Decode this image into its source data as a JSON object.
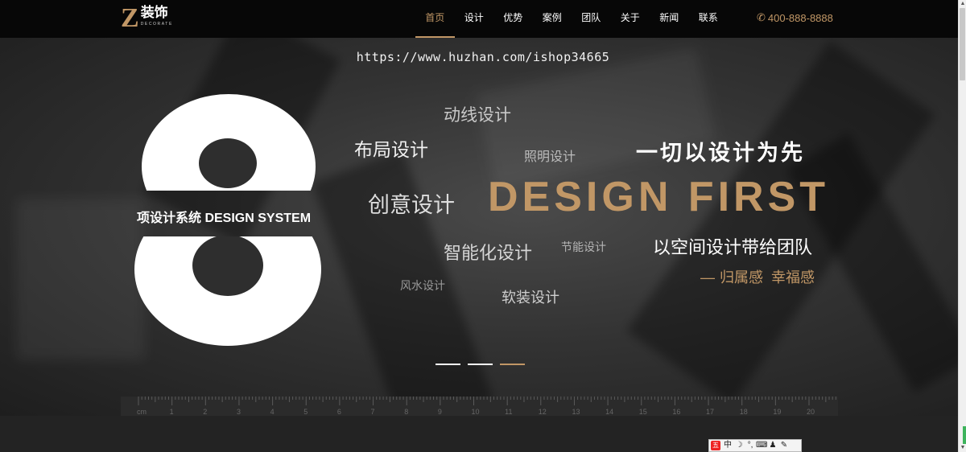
{
  "header": {
    "logo": {
      "letter": "Z",
      "name": "装饰",
      "sub": "DECORATE"
    },
    "nav": [
      {
        "label": "首页",
        "active": true
      },
      {
        "label": "设计",
        "active": false
      },
      {
        "label": "优势",
        "active": false
      },
      {
        "label": "案例",
        "active": false
      },
      {
        "label": "团队",
        "active": false
      },
      {
        "label": "关于",
        "active": false
      },
      {
        "label": "新闻",
        "active": false
      },
      {
        "label": "联系",
        "active": false
      }
    ],
    "phone": {
      "icon": "phone-icon",
      "glyph": "✆",
      "number": "400-888-8888"
    }
  },
  "hero": {
    "watermark": "https://www.huzhan.com/ishop34665",
    "eight_label": "项设计系统 DESIGN SYSTEM",
    "words": {
      "dongxian": "动线设计",
      "buju": "布局设计",
      "zhaoming": "照明设计",
      "chuangyi": "创意设计",
      "zhineng": "智能化设计",
      "jieneng": "节能设计",
      "fengshui": "风水设计",
      "ruanzhuang": "软装设计"
    },
    "slogan": "一切以设计为先",
    "design_first": "DESIGN FIRST",
    "tagline": "以空间设计带给团队",
    "belong": {
      "dash": "—",
      "text": "归属感  幸福感"
    },
    "slides": {
      "count": 3,
      "active_index": 2
    }
  },
  "ruler": {
    "unit": "cm",
    "numbers": [
      "1",
      "2",
      "3",
      "4",
      "5",
      "6",
      "7",
      "8",
      "9",
      "10",
      "11",
      "12",
      "13",
      "14",
      "15",
      "16",
      "17",
      "18",
      "19",
      "20"
    ]
  },
  "ime_toolbar": {
    "items": [
      "五",
      "中",
      "☽",
      "°,",
      "⌨",
      "♟",
      "✎"
    ]
  },
  "colors": {
    "accent": "#c19766",
    "header_bg": "#070707"
  }
}
